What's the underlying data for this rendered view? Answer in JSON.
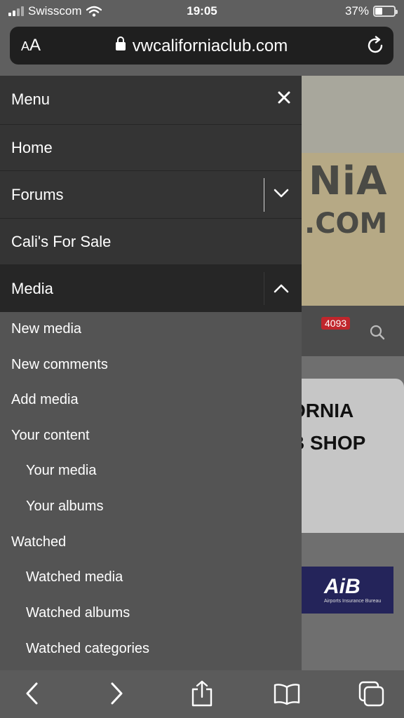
{
  "status_bar": {
    "carrier": "Swisscom",
    "time": "19:05",
    "battery": "37%",
    "battery_level": 0.37
  },
  "url_bar": {
    "text_size_button": "AA",
    "url": "vwcaliforniaclub.com",
    "reload_icon": "reload-icon",
    "lock_icon": "lock-icon"
  },
  "background_page": {
    "banner_text_1": "NiA",
    "banner_text_2": ".COM",
    "notification_count": "4093",
    "card_line_1": "ORNIA",
    "card_line_2": "B SHOP",
    "ad_logo": "AiB",
    "ad_subtitle": "Airports Insurance Bureau"
  },
  "menu": {
    "title": "Menu",
    "close_icon": "close-icon",
    "items": [
      {
        "label": "Home"
      },
      {
        "label": "Forums"
      },
      {
        "label": "Cali's For Sale"
      },
      {
        "label": "Media"
      }
    ],
    "media_subitems": [
      {
        "label": "New media"
      },
      {
        "label": "New comments"
      },
      {
        "label": "Add media"
      },
      {
        "label": "Your content"
      },
      {
        "label": "Your media"
      },
      {
        "label": "Your albums"
      },
      {
        "label": "Watched"
      },
      {
        "label": "Watched media"
      },
      {
        "label": "Watched albums"
      },
      {
        "label": "Watched categories"
      }
    ]
  },
  "toolbar": {
    "back_icon": "back-icon",
    "forward_icon": "forward-icon",
    "share_icon": "share-icon",
    "bookmarks_icon": "bookmarks-icon",
    "tabs_icon": "tabs-icon"
  },
  "colors": {
    "menu_header_bg": "#343434",
    "menu_active_bg": "#262626",
    "submenu_bg": "#545454",
    "badge_red": "#c0262c"
  }
}
